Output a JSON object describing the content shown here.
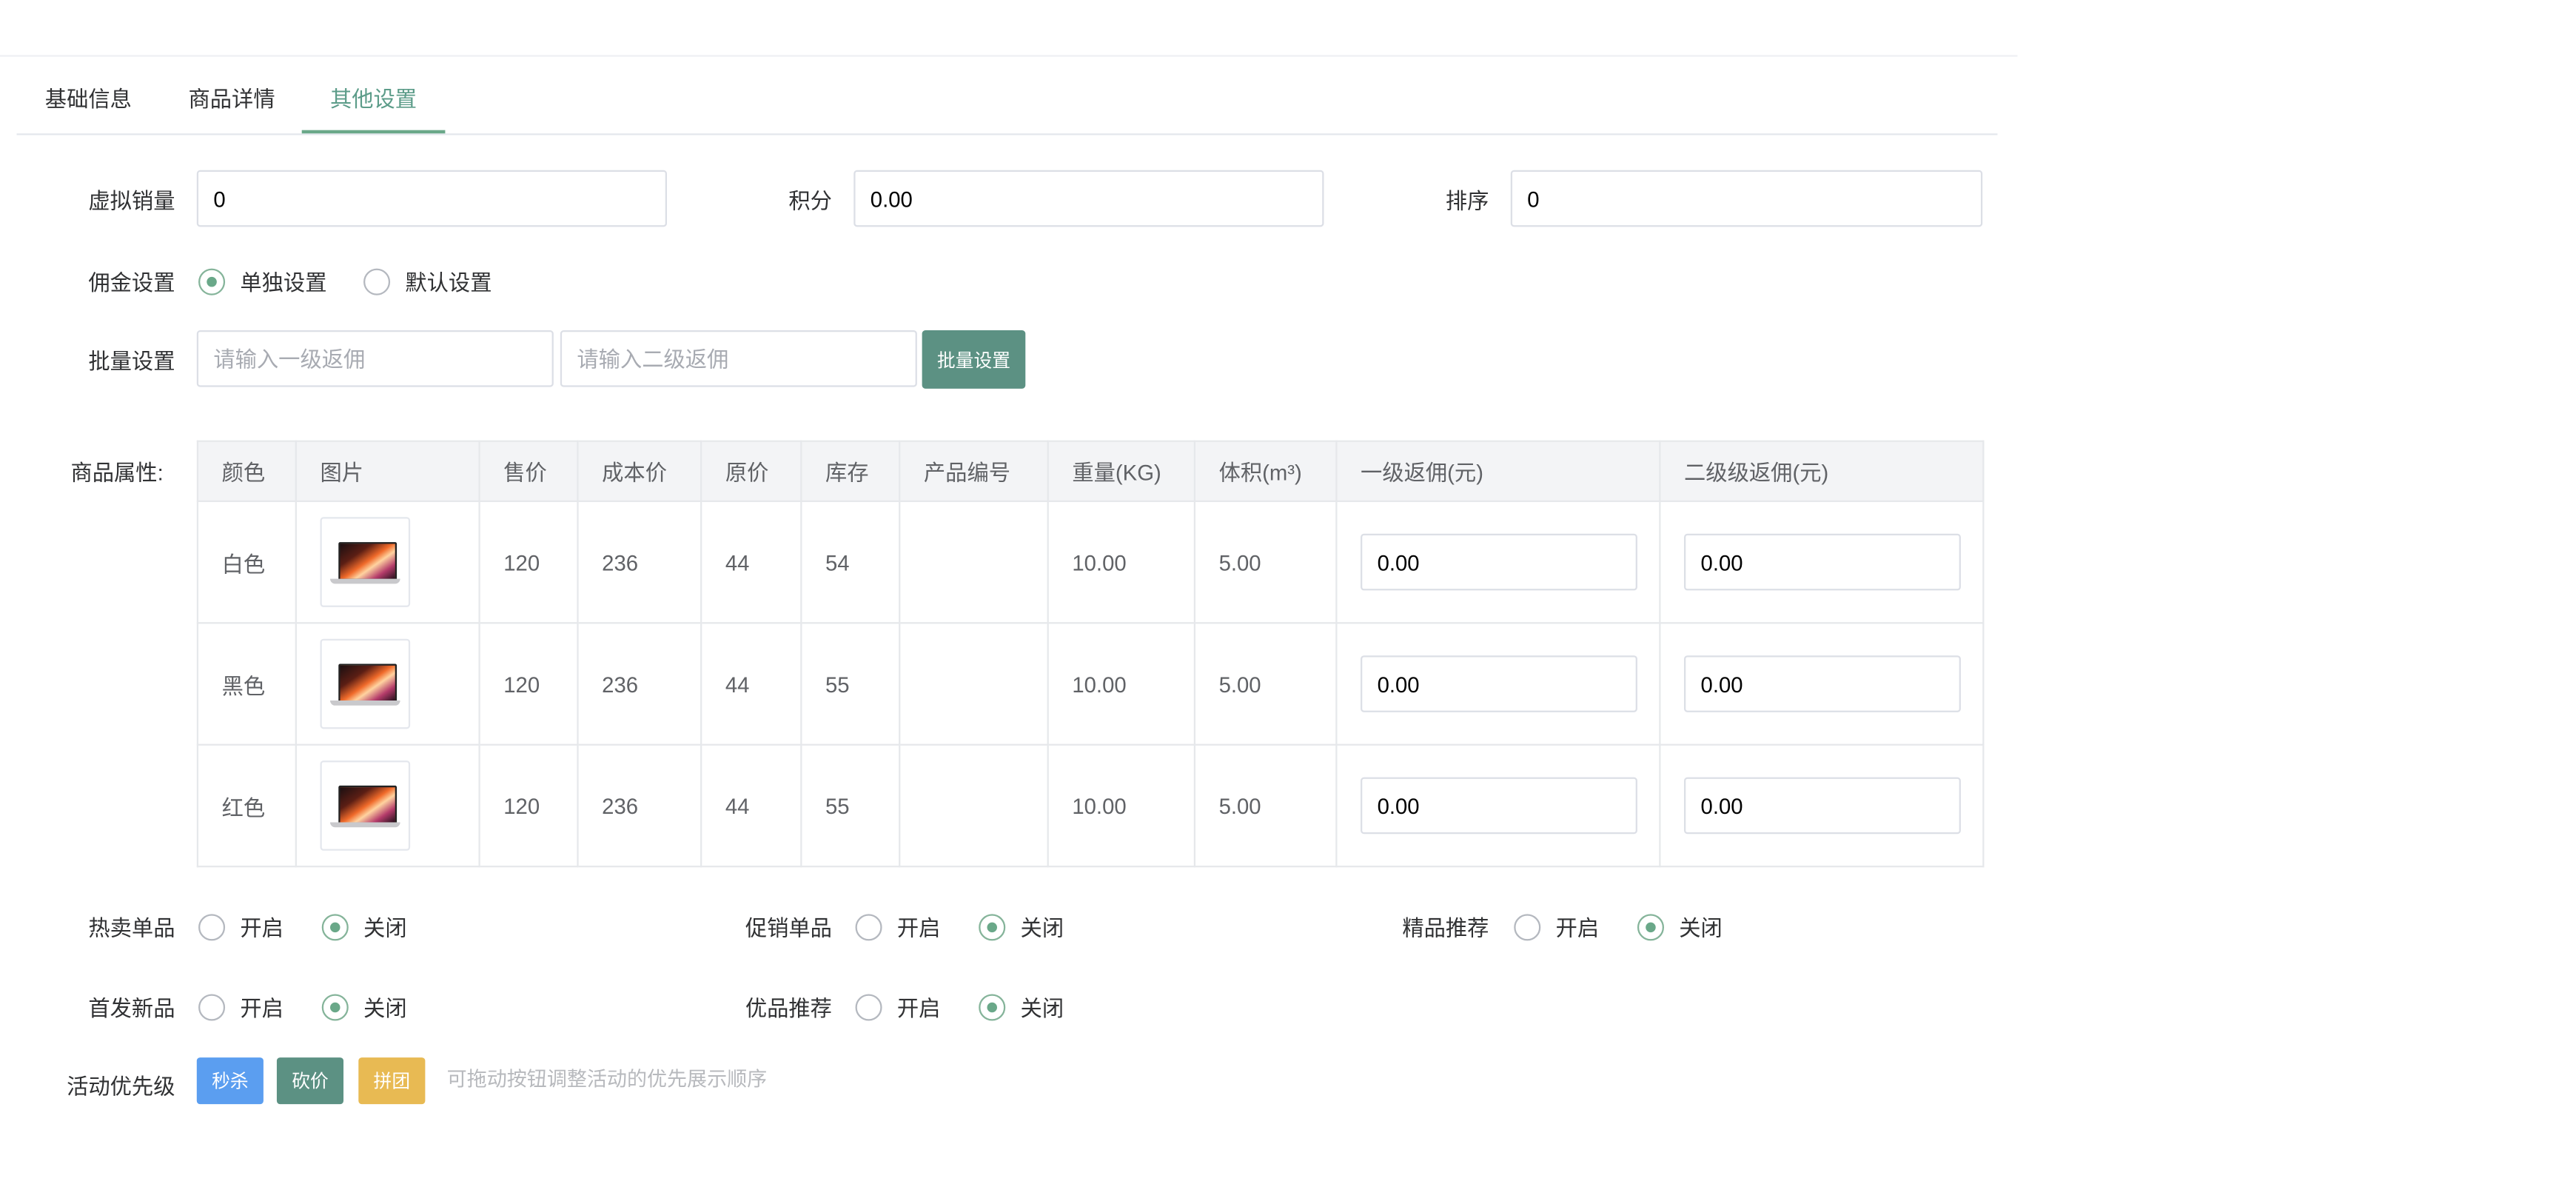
{
  "tabs": [
    {
      "label": "基础信息",
      "active": false
    },
    {
      "label": "商品详情",
      "active": false
    },
    {
      "label": "其他设置",
      "active": true
    }
  ],
  "basic": {
    "virtual_sales": {
      "label": "虚拟销量",
      "value": "0"
    },
    "points": {
      "label": "积分",
      "value": "0.00"
    },
    "sort": {
      "label": "排序",
      "value": "0"
    }
  },
  "commission": {
    "label": "佣金设置",
    "options": [
      {
        "label": "单独设置",
        "checked": true
      },
      {
        "label": "默认设置",
        "checked": false
      }
    ]
  },
  "batch": {
    "label": "批量设置",
    "level1_placeholder": "请输入一级返佣",
    "level2_placeholder": "请输入二级返佣",
    "button_label": "批量设置"
  },
  "attributes": {
    "label": "商品属性:",
    "headers": [
      "颜色",
      "图片",
      "售价",
      "成本价",
      "原价",
      "库存",
      "产品编号",
      "重量(KG)",
      "体积(m³)",
      "一级返佣(元)",
      "二级级返佣(元)"
    ],
    "rows": [
      {
        "color": "白色",
        "image_icon": "laptop-thumbnail",
        "price": "120",
        "cost": "236",
        "original": "44",
        "stock": "54",
        "code": "",
        "weight": "10.00",
        "volume": "5.00",
        "level1": "0.00",
        "level2": "0.00"
      },
      {
        "color": "黑色",
        "image_icon": "laptop-thumbnail",
        "price": "120",
        "cost": "236",
        "original": "44",
        "stock": "55",
        "code": "",
        "weight": "10.00",
        "volume": "5.00",
        "level1": "0.00",
        "level2": "0.00"
      },
      {
        "color": "红色",
        "image_icon": "laptop-thumbnail",
        "price": "120",
        "cost": "236",
        "original": "44",
        "stock": "55",
        "code": "",
        "weight": "10.00",
        "volume": "5.00",
        "level1": "0.00",
        "level2": "0.00"
      }
    ]
  },
  "toggles": {
    "on_label": "开启",
    "off_label": "关闭",
    "hot": {
      "label": "热卖单品",
      "on": false
    },
    "promo": {
      "label": "促销单品",
      "on": false
    },
    "featured": {
      "label": "精品推荐",
      "on": false
    },
    "new": {
      "label": "首发新品",
      "on": false
    },
    "quality": {
      "label": "优品推荐",
      "on": false
    }
  },
  "activity": {
    "label": "活动优先级",
    "buttons": [
      {
        "label": "秒杀",
        "color": "#5b9ef0"
      },
      {
        "label": "砍价",
        "color": "#5c9183"
      },
      {
        "label": "拼团",
        "color": "#e8ba53"
      }
    ],
    "hint": "可拖动按钮调整活动的优先展示顺序"
  },
  "colors": {
    "accent": "#5c9c89",
    "primary_button": "#5c9183"
  }
}
